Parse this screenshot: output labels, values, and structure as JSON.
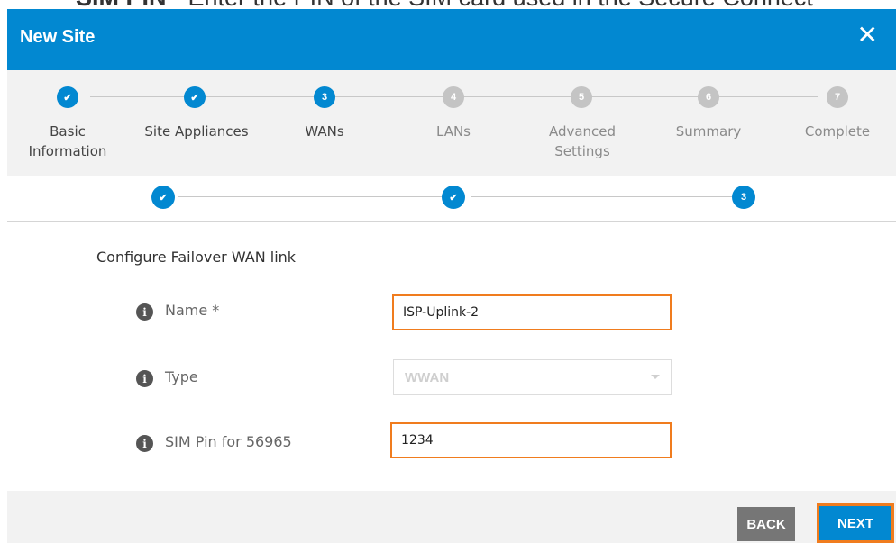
{
  "doc_fragment": {
    "bold": "SIM PIN",
    "text": " - Enter the PIN of the SIM card used in the Secure Connect"
  },
  "dialog": {
    "title": "New Site",
    "close_icon": "close-icon"
  },
  "steps": [
    {
      "number": "1",
      "label": "Basic Information",
      "state": "done"
    },
    {
      "number": "2",
      "label": "Site Appliances",
      "state": "done"
    },
    {
      "number": "3",
      "label": "WANs",
      "state": "active"
    },
    {
      "number": "4",
      "label": "LANs",
      "state": "todo"
    },
    {
      "number": "5",
      "label": "Advanced Settings",
      "state": "todo"
    },
    {
      "number": "6",
      "label": "Summary",
      "state": "todo"
    },
    {
      "number": "7",
      "label": "Complete",
      "state": "todo"
    }
  ],
  "substeps": [
    {
      "number": "1",
      "state": "done"
    },
    {
      "number": "2",
      "state": "done"
    },
    {
      "number": "3",
      "state": "active"
    }
  ],
  "form": {
    "section_title": "Configure Failover WAN link",
    "name": {
      "label": "Name *",
      "value": "ISP-Uplink-2"
    },
    "type": {
      "label": "Type",
      "value": "WWAN"
    },
    "sim_pin": {
      "label": "SIM Pin for 56965",
      "value": "1234"
    }
  },
  "footer": {
    "back_label": "BACK",
    "next_label": "NEXT"
  },
  "colors": {
    "accent": "#0288d1",
    "highlight": "#f07c1e",
    "inactive": "#c4c4c4"
  }
}
